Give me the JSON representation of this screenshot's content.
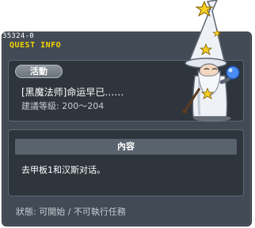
{
  "window": {
    "quest_id": "35324-0",
    "title": "QUEST INFO"
  },
  "summary": {
    "category": "活動",
    "quest_name": "[黑魔法师]命运早已……",
    "level_requirement": "建議等級: 200～204"
  },
  "content": {
    "header": "內容",
    "description": "去甲板1和汉斯对话。"
  },
  "status": {
    "text": "狀態: 可開始 / 不可執行任務"
  },
  "npc": {
    "icon": "wizard-npc-icon"
  },
  "colors": {
    "window_bg": "#424a55",
    "inner_box_bg": "#2f353d",
    "title_yellow": "#f5d400",
    "badge_gray": "#7a828b"
  }
}
